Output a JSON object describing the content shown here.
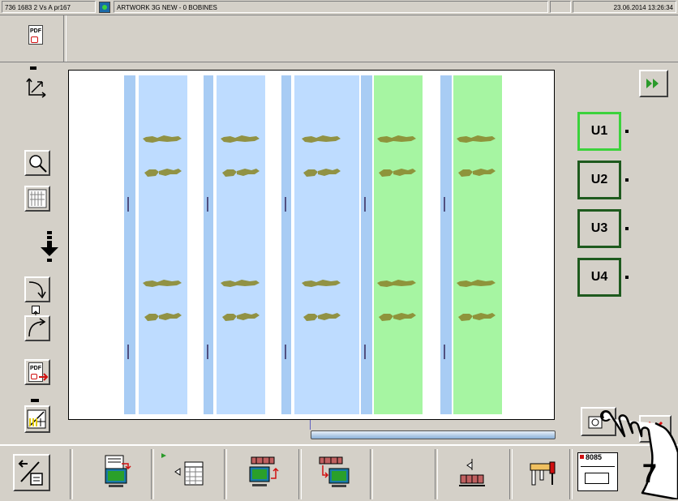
{
  "titlebar": {
    "job_id": "736 1683 2 Vs A pr167",
    "job_title": "ARTWORK 3G NEW - 0 BOBINES",
    "datetime": "23.06.2014 13:26:34"
  },
  "top_toolbar": {
    "pdf_label": "PDF"
  },
  "left_toolbar": {
    "pdf_export_label": "PDF"
  },
  "units": [
    {
      "label": "U1",
      "active": true
    },
    {
      "label": "U2",
      "active": false
    },
    {
      "label": "U3",
      "active": false
    },
    {
      "label": "U4",
      "active": false
    }
  ],
  "overlay": {
    "step_number": "7"
  },
  "bottom_toolbar": {
    "press_label": "8085"
  },
  "colors": {
    "lane_blue": "#bedcff",
    "lane_blue_edge": "#a8ccf4",
    "lane_green": "#a6f5a2",
    "unit_border": "#1e5a1e",
    "unit_active_border": "#3cd23c",
    "close_red": "#e01010",
    "pattern_olive": "#8c8a30"
  }
}
